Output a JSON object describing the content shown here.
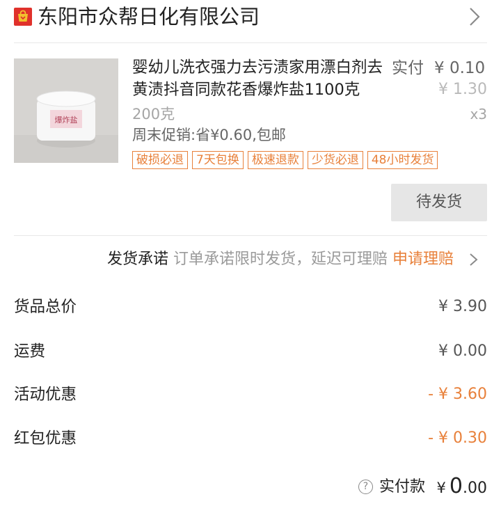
{
  "shop": {
    "name": "东阳市众帮日化有限公司",
    "icon": "shop-bag-icon",
    "brand_color": "#e0312b"
  },
  "product": {
    "title": "婴幼儿洗衣强力去污渍家用漂白剂去黄渍抖音同款花香爆炸盐1100克",
    "paid_label": "实付",
    "paid_value": "¥ 0.10",
    "original_price": "¥ 1.30",
    "spec": "200克",
    "quantity": "x3",
    "promo": "周末促销:省¥0.60,包邮",
    "tags": [
      "破损必退",
      "7天包换",
      "极速退款",
      "少货必退",
      "48小时发货"
    ],
    "thumbnail_label": "爆炸盐",
    "status_button": "待发货"
  },
  "promise": {
    "label": "发货承诺",
    "text": "订单承诺限时发货，延迟可理赔",
    "action": "申请理赔"
  },
  "summary": [
    {
      "label": "货品总价",
      "value": "¥ 3.90"
    },
    {
      "label": "运费",
      "value": "¥ 0.00"
    },
    {
      "label": "活动优惠",
      "value": "- ¥ 3.60"
    },
    {
      "label": "红包优惠",
      "value": "- ¥ 0.30"
    }
  ],
  "total": {
    "label": "实付款",
    "currency": "¥",
    "integer": "0",
    "decimal": ".00"
  },
  "colors": {
    "accent": "#e8803a",
    "status_button_bg": "#e6e6e6"
  }
}
